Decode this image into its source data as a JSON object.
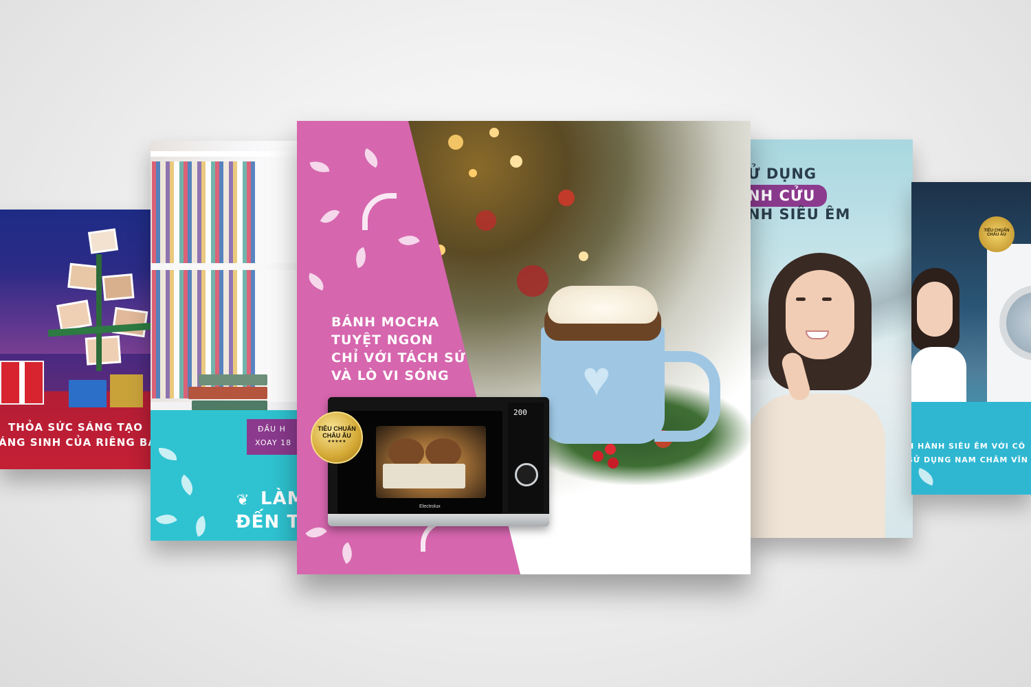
{
  "cards": {
    "far_left": {
      "line1": "THỎA SỨC SÁNG TẠO",
      "line2": "ÁNG SINH CỦA RIÊNG BẠN"
    },
    "left": {
      "tag1": "ĐẦU H",
      "tag2": "XOAY 18",
      "headline1": "LÀM",
      "headline2": "ĐẾN TỪ"
    },
    "center": {
      "title": [
        "BÁNH MOCHA",
        "TUYỆT NGON",
        "CHỈ VỚI TÁCH SỨ",
        "VÀ LÒ VI SÓNG"
      ],
      "badge_line1": "TIÊU CHUẨN",
      "badge_line2": "CHÂU ÂU",
      "badge_stars": "★★★★★",
      "microwave_display": "200",
      "microwave_brand": "Electrolux"
    },
    "right": {
      "line1": "Ử DỤNG",
      "line2": "NH CỬU",
      "line3": "NH SIÊU ÊM"
    },
    "far_right": {
      "badge": "TIÊU CHUẨN CHÂU ÂU",
      "line1": "H HÀNH SIÊU ÊM VỚI CÔ",
      "line2": "SỬ DỤNG NAM CHÂM VĨN"
    }
  },
  "colors": {
    "pink": "#d666ae",
    "teal": "#2fc3d1",
    "red": "#c41f35",
    "navy": "#1d2c86",
    "purple": "#8b3a8e",
    "gold": "#d4a935"
  }
}
